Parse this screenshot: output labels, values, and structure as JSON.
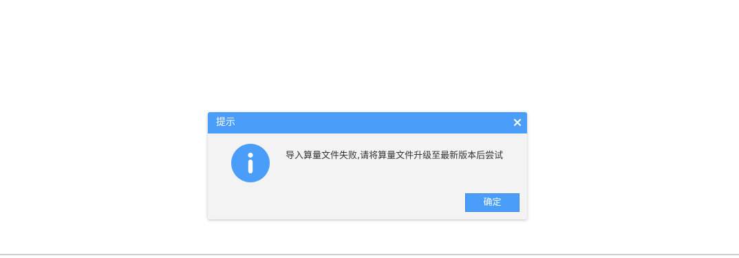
{
  "dialog": {
    "title": "提示",
    "message": "导入算量文件失败,请将算量文件升级至最新版本后尝试",
    "ok_label": "确定",
    "icon": "info-icon",
    "close_icon": "close-icon"
  },
  "colors": {
    "accent": "#4a9df8",
    "dialog_bg": "#f3f3f3",
    "text": "#333333"
  }
}
